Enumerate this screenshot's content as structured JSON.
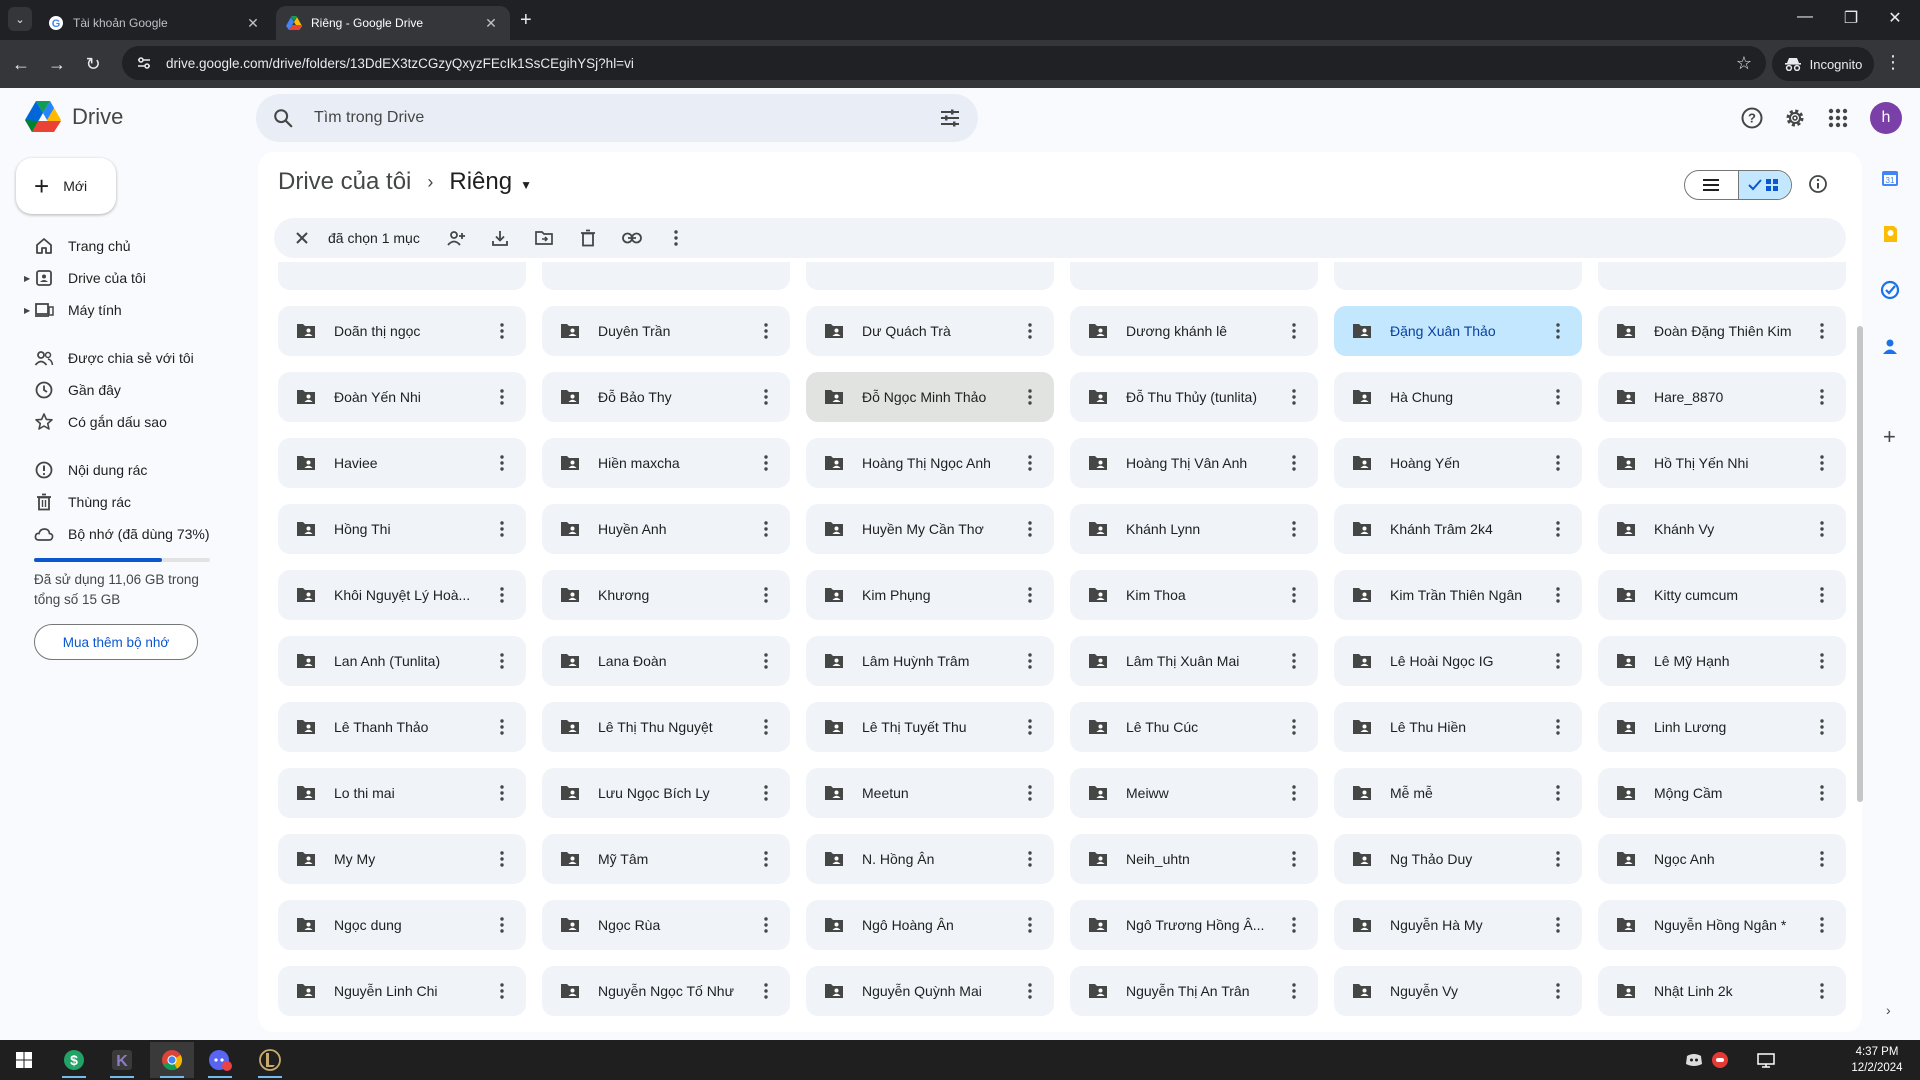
{
  "browser": {
    "tabs": [
      {
        "title": "Tài khoản Google",
        "active": false
      },
      {
        "title": "Riêng - Google Drive",
        "active": true
      }
    ],
    "url": "drive.google.com/drive/folders/13DdEX3tzCGzyQxyzFEcIk1SsCEgihYSj?hl=vi",
    "incognito_label": "Incognito"
  },
  "app": {
    "brand": "Drive",
    "search_placeholder": "Tìm trong Drive",
    "avatar_letter": "h"
  },
  "sidebar": {
    "new_label": "Mới",
    "items": [
      {
        "label": "Trang chủ",
        "icon": "home-icon"
      },
      {
        "label": "Drive của tôi",
        "icon": "my-drive-icon"
      },
      {
        "label": "Máy tính",
        "icon": "computer-icon"
      },
      {
        "label": "Được chia sẻ với tôi",
        "icon": "shared-icon"
      },
      {
        "label": "Gần đây",
        "icon": "clock-icon"
      },
      {
        "label": "Có gắn dấu sao",
        "icon": "star-icon"
      },
      {
        "label": "Nội dung rác",
        "icon": "spam-icon"
      },
      {
        "label": "Thùng rác",
        "icon": "trash-icon"
      },
      {
        "label": "Bộ nhớ (đã dùng 73%)",
        "icon": "cloud-icon"
      }
    ],
    "storage_used_fraction": 0.73,
    "storage_text": "Đã sử dụng 11,06 GB trong tổng số 15 GB",
    "buy_label": "Mua thêm bộ nhớ"
  },
  "main": {
    "breadcrumb_root": "Drive của tôi",
    "breadcrumb_current": "Riêng",
    "selection_text": "đã chọn 1 mục",
    "folders": [
      "Doãn thị ngọc",
      "Duyên Trần",
      "Dư Quách Trà",
      "Dương khánh lê",
      "Đặng Xuân Thảo",
      "Đoàn Đặng Thiên Kim",
      "Đoàn Yến Nhi",
      "Đỗ Bảo Thy",
      "Đỗ Ngọc Minh Thảo",
      "Đỗ Thu Thủy (tunlita)",
      "Hà Chung",
      "Hare_8870",
      "Haviee",
      "Hiền maxcha",
      "Hoàng Thị Ngọc Anh",
      "Hoàng Thị Vân Anh",
      "Hoàng Yến",
      "Hồ Thị Yến Nhi",
      "Hồng Thi",
      "Huyền Anh",
      "Huyền My Cần Thơ",
      "Khánh Lynn",
      "Khánh Trâm 2k4",
      "Khánh Vy",
      "Khôi Nguyệt Lý Hoà...",
      "Khương",
      "Kim Phụng",
      "Kim Thoa",
      "Kim Trần Thiên Ngân",
      "Kitty cumcum",
      "Lan Anh (Tunlita)",
      "Lana Đoàn",
      "Lâm Huỳnh Trâm",
      "Lâm Thị Xuân Mai",
      "Lê Hoài Ngọc IG",
      "Lê Mỹ Hạnh",
      "Lê Thanh Thảo",
      "Lê Thị Thu Nguyệt",
      "Lê Thị Tuyết Thu",
      "Lê Thu Cúc",
      "Lê Thu Hiền",
      "Linh Lương",
      "Lo thi mai",
      "Lưu Ngọc Bích Ly",
      "Meetun",
      "Meiww",
      "Mễ mễ",
      "Mộng Cầm",
      "My My",
      "Mỹ Tâm",
      "N. Hồng Ân",
      "Neih_uhtn",
      "Ng Thảo Duy",
      "Ngọc Anh",
      "Ngọc dung",
      "Ngọc Rùa",
      "Ngô Hoàng Ân",
      "Ngô Trương Hồng Â...",
      "Nguyễn Hà My",
      "Nguyễn Hồng Ngân *",
      "Nguyễn Linh Chi",
      "Nguyễn Ngọc Tố Như",
      "Nguyễn Quỳnh Mai",
      "Nguyễn Thị An Trân",
      "Nguyễn Vy",
      "Nhật Linh 2k"
    ],
    "selected_folder": "Đặng Xuân Thảo",
    "hover_folder": "Đỗ Ngọc Minh Thảo"
  },
  "taskbar": {
    "time": "4:37 PM",
    "date": "12/2/2024"
  },
  "colors": {
    "accent": "#0b57d0",
    "selected_bg": "#c2e7ff",
    "cell_bg": "#f0f4f9"
  }
}
